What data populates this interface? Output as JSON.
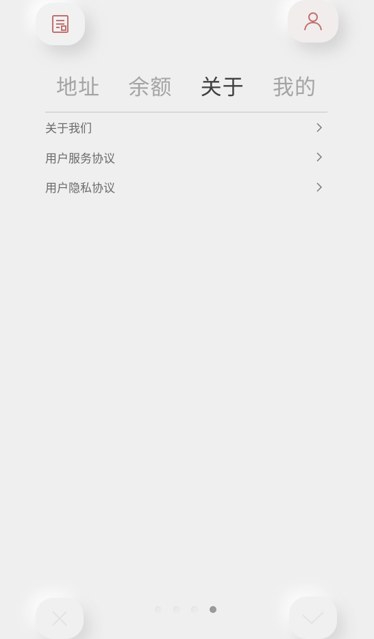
{
  "header": {
    "left_icon": "document-icon",
    "right_icon": "user-icon"
  },
  "tabs": [
    {
      "label": "地址",
      "active": false
    },
    {
      "label": "余额",
      "active": false
    },
    {
      "label": "关于",
      "active": true
    },
    {
      "label": "我的",
      "active": false
    }
  ],
  "menu": [
    {
      "label": "关于我们"
    },
    {
      "label": "用户服务协议"
    },
    {
      "label": "用户隐私协议"
    }
  ],
  "footer": {
    "left_icon": "close-icon",
    "right_icon": "check-icon",
    "page_count": 4,
    "current_page": 4
  },
  "colors": {
    "background": "#efefef",
    "accent": "#c0706f",
    "active_text": "#3f3f3f",
    "inactive_text": "#a4a4a4"
  }
}
